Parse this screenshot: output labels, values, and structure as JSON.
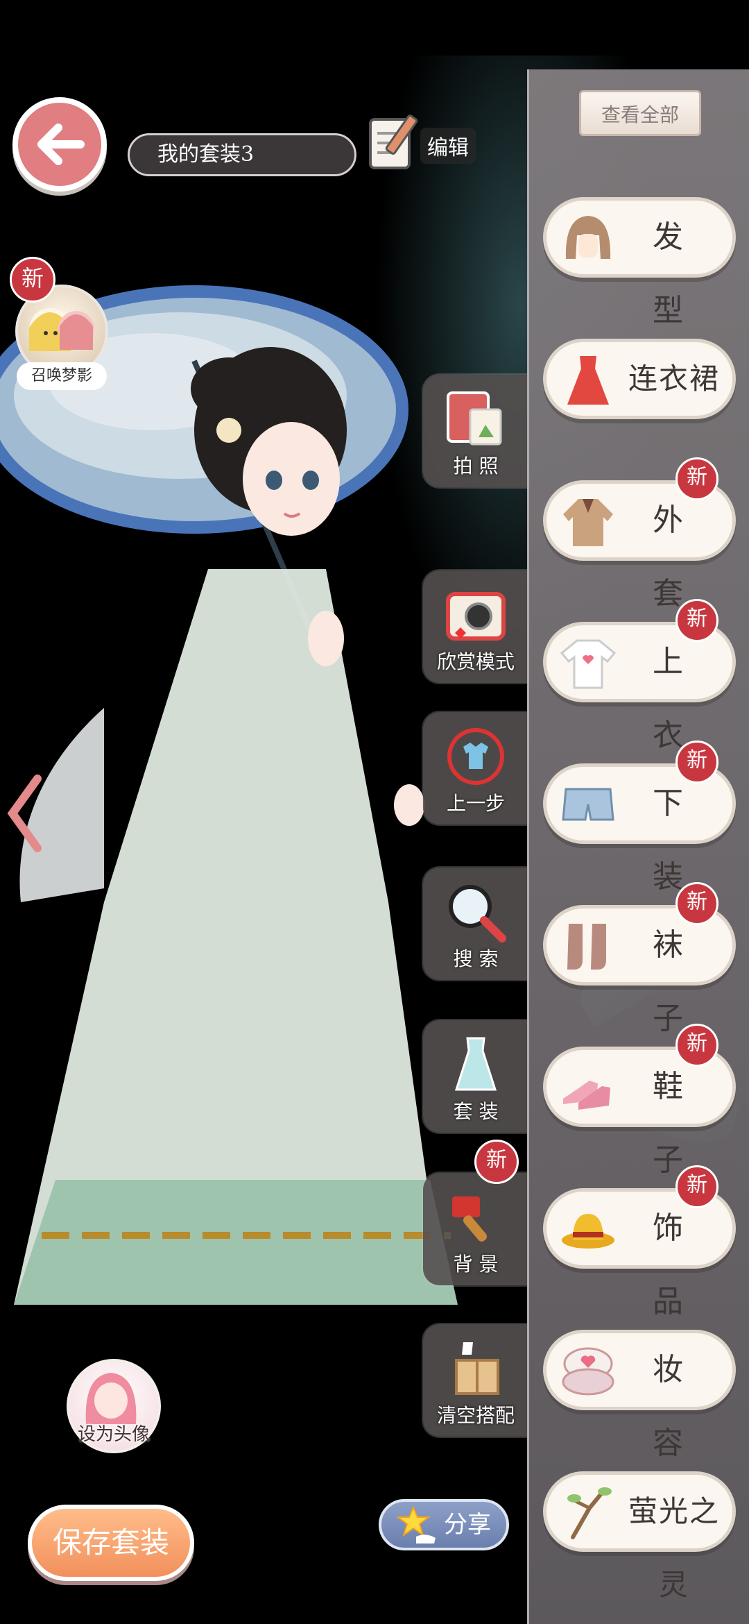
{
  "header": {
    "outfit_name": "我的套装3",
    "edit_label": "编辑"
  },
  "summon": {
    "badge": "新",
    "label": "召唤梦影"
  },
  "tools": [
    {
      "id": "photo",
      "label": "拍 照",
      "icon": "photo-album-icon",
      "badge": ""
    },
    {
      "id": "appreciate",
      "label": "欣赏模式",
      "icon": "camera-icon",
      "badge": ""
    },
    {
      "id": "undo",
      "label": "上一步",
      "icon": "undo-shirt-icon",
      "badge": ""
    },
    {
      "id": "search",
      "label": "搜 索",
      "icon": "magnifier-icon",
      "badge": ""
    },
    {
      "id": "suit",
      "label": "套 装",
      "icon": "dress-set-icon",
      "badge": ""
    },
    {
      "id": "background",
      "label": "背 景",
      "icon": "paintbrush-icon",
      "badge": "新"
    },
    {
      "id": "clear",
      "label": "清空搭配",
      "icon": "box-icon",
      "badge": ""
    }
  ],
  "panel": {
    "view_all": "查看全部",
    "categories": [
      {
        "id": "hair",
        "label": "发 型",
        "icon": "hair-icon",
        "badge": ""
      },
      {
        "id": "dress",
        "label": "连衣裙",
        "icon": "dress-icon",
        "badge": ""
      },
      {
        "id": "coat",
        "label": "外 套",
        "icon": "coat-icon",
        "badge": "新"
      },
      {
        "id": "top",
        "label": "上 衣",
        "icon": "shirt-icon",
        "badge": "新"
      },
      {
        "id": "bottom",
        "label": "下 装",
        "icon": "shorts-icon",
        "badge": "新"
      },
      {
        "id": "socks",
        "label": "袜 子",
        "icon": "socks-icon",
        "badge": "新"
      },
      {
        "id": "shoes",
        "label": "鞋 子",
        "icon": "heels-icon",
        "badge": "新"
      },
      {
        "id": "accessory",
        "label": "饰 品",
        "icon": "hat-icon",
        "badge": "新"
      },
      {
        "id": "makeup",
        "label": "妆 容",
        "icon": "compact-icon",
        "badge": ""
      },
      {
        "id": "firefly",
        "label": "萤光之灵",
        "icon": "branch-icon",
        "badge": ""
      }
    ]
  },
  "bottom": {
    "set_avatar": "设为头像",
    "save": "保存套装",
    "share": "分享"
  },
  "colors": {
    "accent_red": "#c8373f",
    "back_button": "#e07e82",
    "save_button": "#f2905c"
  }
}
